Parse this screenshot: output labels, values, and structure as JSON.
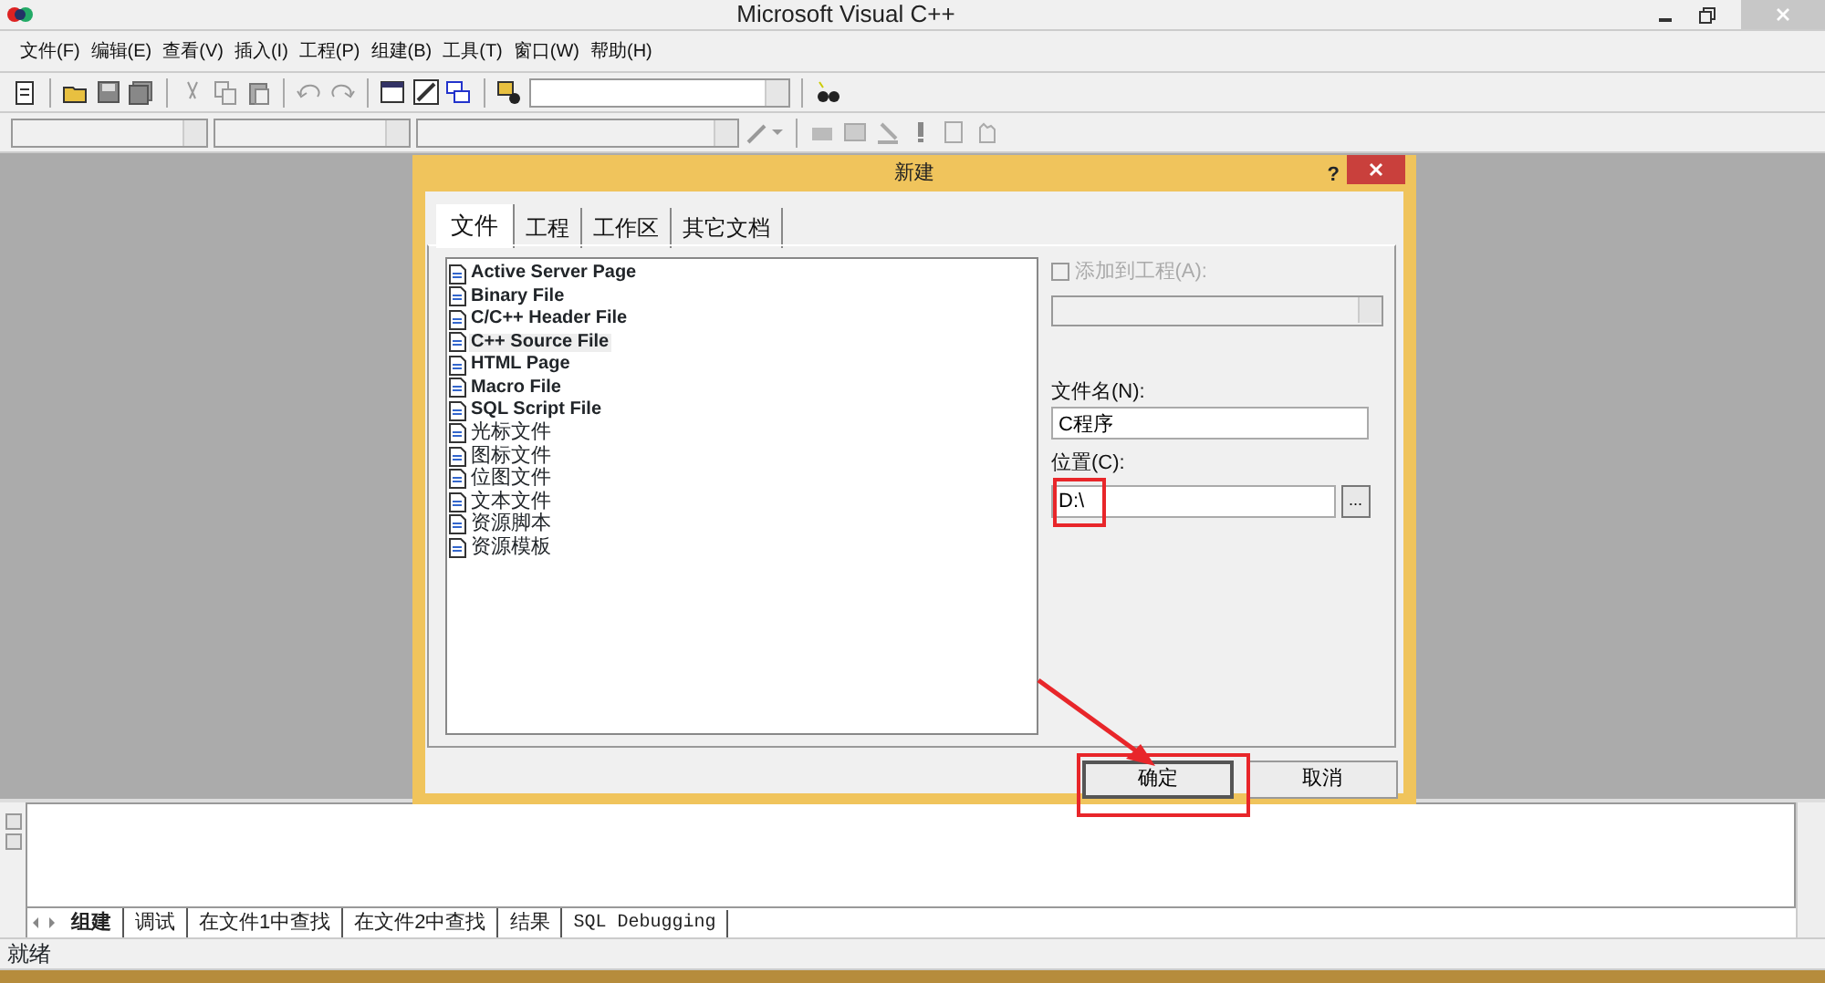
{
  "window": {
    "title": "Microsoft Visual C++"
  },
  "menu": [
    {
      "label": "文件(F)"
    },
    {
      "label": "编辑(E)"
    },
    {
      "label": "查看(V)"
    },
    {
      "label": "插入(I)"
    },
    {
      "label": "工程(P)"
    },
    {
      "label": "组建(B)"
    },
    {
      "label": "工具(T)"
    },
    {
      "label": "窗口(W)"
    },
    {
      "label": "帮助(H)"
    }
  ],
  "dialog": {
    "title": "新建",
    "help": "?",
    "tabs": [
      {
        "label": "文件",
        "selected": true
      },
      {
        "label": "工程",
        "selected": false
      },
      {
        "label": "工作区",
        "selected": false
      },
      {
        "label": "其它文档",
        "selected": false
      }
    ],
    "file_types": [
      {
        "label": "Active Server Page",
        "selected": false
      },
      {
        "label": "Binary File",
        "selected": false
      },
      {
        "label": "C/C++ Header File",
        "selected": false
      },
      {
        "label": "C++ Source File",
        "selected": true
      },
      {
        "label": "HTML Page",
        "selected": false
      },
      {
        "label": "Macro File",
        "selected": false
      },
      {
        "label": "SQL Script File",
        "selected": false
      },
      {
        "label": "光标文件",
        "selected": false
      },
      {
        "label": "图标文件",
        "selected": false
      },
      {
        "label": "位图文件",
        "selected": false
      },
      {
        "label": "文本文件",
        "selected": false
      },
      {
        "label": "资源脚本",
        "selected": false
      },
      {
        "label": "资源模板",
        "selected": false
      }
    ],
    "add_to_project": {
      "label": "添加到工程(A):",
      "checked": false,
      "disabled": true
    },
    "file_name": {
      "label": "文件名(N):",
      "value": "C程序"
    },
    "location": {
      "label": "位置(C):",
      "value": "D:\\",
      "browse": "..."
    },
    "buttons": [
      {
        "label": "确定",
        "default": true
      },
      {
        "label": "取消",
        "default": false
      }
    ]
  },
  "output_tabs": [
    {
      "label": "组建",
      "selected": true
    },
    {
      "label": "调试",
      "selected": false
    },
    {
      "label": "在文件1中查找",
      "selected": false
    },
    {
      "label": "在文件2中查找",
      "selected": false
    },
    {
      "label": "结果",
      "selected": false
    },
    {
      "label": "SQL Debugging",
      "selected": false
    }
  ],
  "status_bar": "就绪"
}
